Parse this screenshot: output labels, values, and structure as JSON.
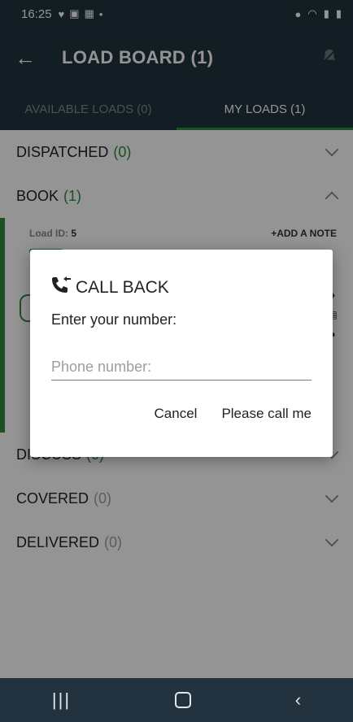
{
  "status": {
    "time": "16:25"
  },
  "appbar": {
    "title": "LOAD BOARD (1)"
  },
  "tabs": [
    {
      "label": "AVAILABLE LOADS (0)"
    },
    {
      "label": "MY LOADS (1)"
    }
  ],
  "sections": [
    {
      "label": "DISPATCHED",
      "count": "(0)"
    },
    {
      "label": "BOOK",
      "count": "(1)"
    },
    {
      "label": "DISCUSS",
      "count": "(0)"
    },
    {
      "label": "COVERED",
      "count": "(0)"
    },
    {
      "label": "DELIVERED",
      "count": "(0)"
    }
  ],
  "card": {
    "load_id_label": "Load ID:",
    "load_id_value": "5",
    "add_note": "+ADD A NOTE"
  },
  "dialog": {
    "title": "CALL BACK",
    "prompt": "Enter your number:",
    "input_placeholder": "Phone number:",
    "cancel": "Cancel",
    "confirm": "Please call me"
  },
  "icons": {
    "accent": "#2e8b3e",
    "bar": "#22323f"
  }
}
